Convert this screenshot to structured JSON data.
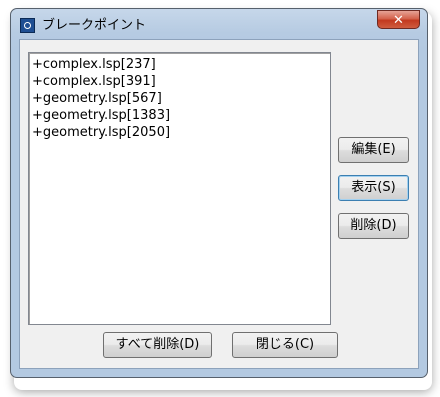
{
  "window": {
    "title": "ブレークポイント",
    "close_glyph": "✕"
  },
  "breakpoints": [
    "+complex.lsp[237]",
    "+complex.lsp[391]",
    "+geometry.lsp[567]",
    "+geometry.lsp[1383]",
    "+geometry.lsp[2050]"
  ],
  "buttons": {
    "edit": "編集(E)",
    "show": "表示(S)",
    "delete": "削除(D)",
    "delete_all": "すべて削除(D)",
    "close": "閉じる(C)"
  },
  "icons": {
    "app": "breakpoint-app-icon",
    "close": "close-icon"
  }
}
